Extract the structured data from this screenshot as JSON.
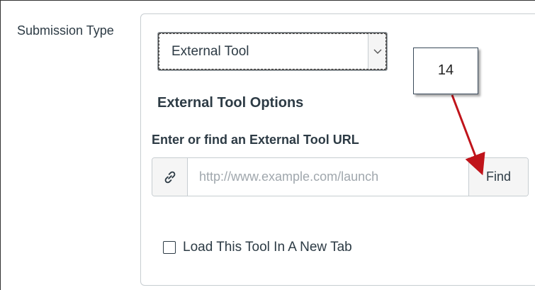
{
  "form": {
    "submission_type_label": "Submission Type",
    "select": {
      "value": "External Tool",
      "caret_icon": "chevron-down-icon"
    },
    "external_tool_options_heading": "External Tool Options",
    "url_field_label": "Enter or find an External Tool URL",
    "url_input": {
      "placeholder": "http://www.example.com/launch",
      "value": "",
      "addon_icon": "link-icon"
    },
    "find_button_label": "Find",
    "new_tab_checkbox": {
      "label": "Load This Tool In A New Tab",
      "checked": false
    }
  },
  "annotation": {
    "callout_number": "14",
    "arrow_color": "#c0141b"
  }
}
